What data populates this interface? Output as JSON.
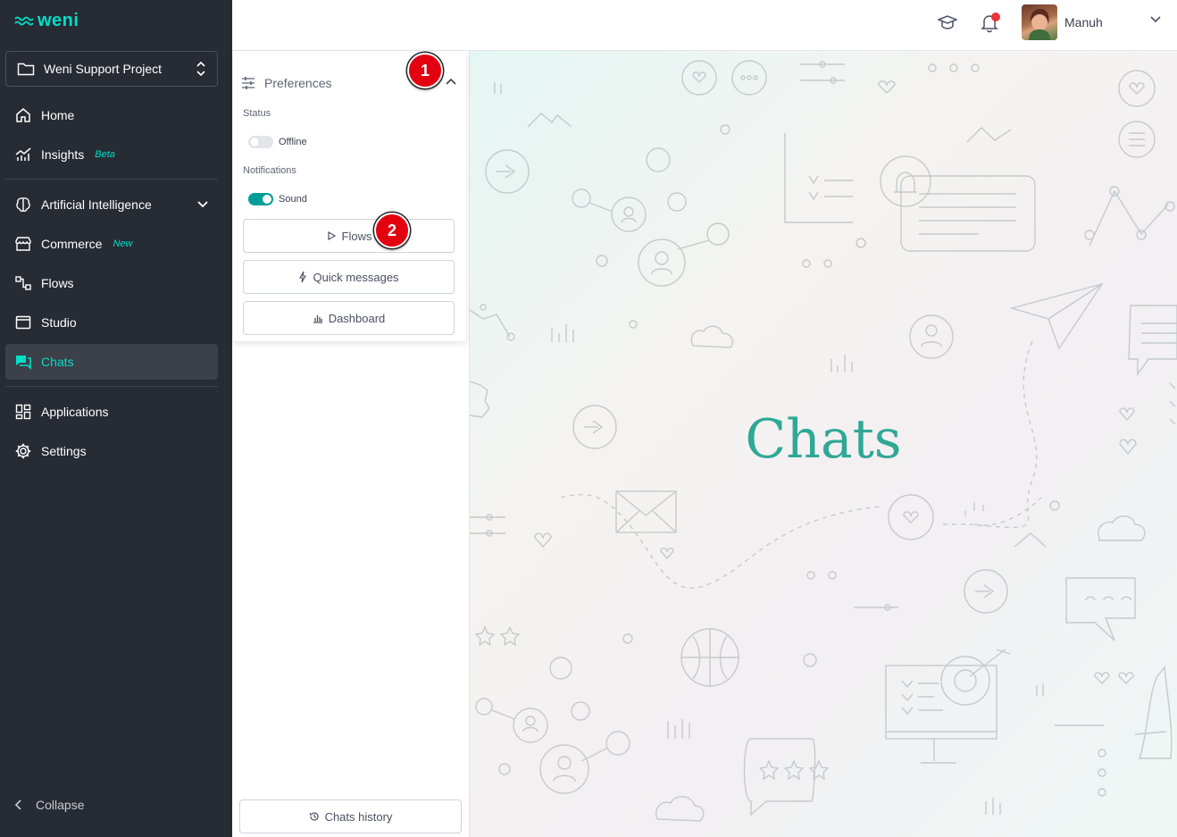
{
  "sidebar": {
    "logo": "weni",
    "project": "Weni Support Project",
    "items": [
      {
        "label": "Home",
        "tag": ""
      },
      {
        "label": "Insights",
        "tag": "Beta"
      },
      {
        "label": "Artificial Intelligence",
        "tag": ""
      },
      {
        "label": "Commerce",
        "tag": "New"
      },
      {
        "label": "Flows",
        "tag": ""
      },
      {
        "label": "Studio",
        "tag": ""
      },
      {
        "label": "Chats",
        "tag": ""
      },
      {
        "label": "Applications",
        "tag": ""
      },
      {
        "label": "Settings",
        "tag": ""
      }
    ],
    "collapse": "Collapse",
    "active": "Chats"
  },
  "topbar": {
    "username": "Manuh",
    "icons": [
      "graduation-cap-icon",
      "bell-icon",
      "chevron-down-icon"
    ],
    "notification_dot_color": "#e8333b"
  },
  "preferences": {
    "title": "Preferences",
    "status_label": "Status",
    "status_value": "Offline",
    "notifications_label": "Notifications",
    "sound_label": "Sound",
    "buttons": [
      "Flows",
      "Quick messages",
      "Dashboard"
    ]
  },
  "chats_history": "Chats history",
  "main": {
    "title": "Chats"
  },
  "badges": [
    "1",
    "2"
  ],
  "colors": {
    "accent": "#00dec7",
    "toggle_on": "#009e96",
    "title": "#2fa896",
    "sidebar_bg": "#272b33"
  }
}
